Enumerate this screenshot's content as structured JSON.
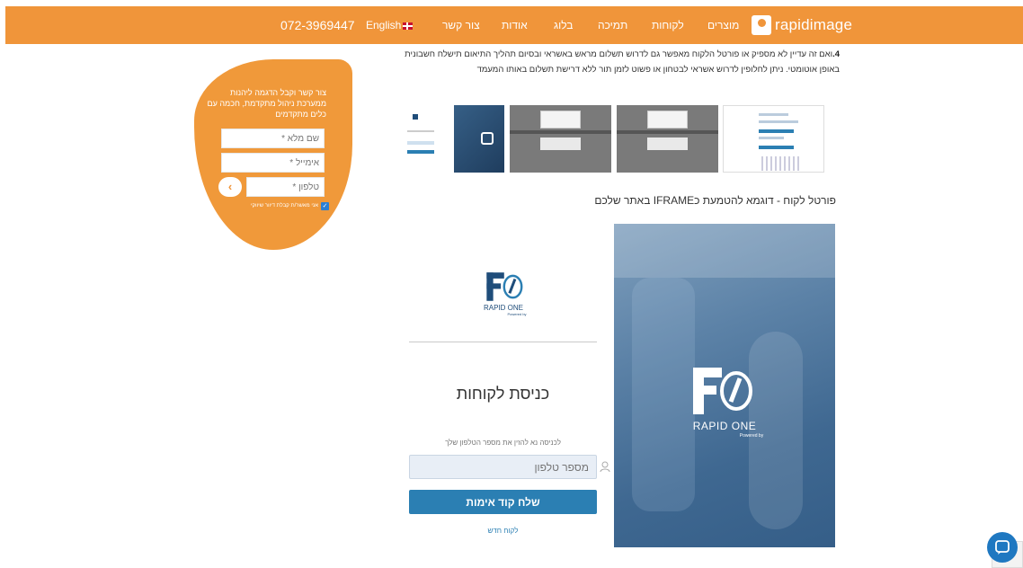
{
  "header": {
    "logo_text": "rapidimage",
    "nav": [
      "מוצרים",
      "לקוחות",
      "תמיכה",
      "בלוג",
      "אודות",
      "צור קשר"
    ],
    "language": "English",
    "phone": "072-3969447"
  },
  "article": {
    "paragraph_prefix": "4.",
    "paragraph": "ואם זה עדיין לא מספיק או פורטל הלקוח מאפשר גם לדרוש תשלום מראש באשראי ובסיום תהליך התיאום תישלח חשבונית באופן אוטומטי. ניתן לחלופין לדרוש אשראי לבטחון או פשוט לזמן תור ללא דרישת תשלום באותו המעמד",
    "iframe_title": "פורטל לקוח - דוגמא להטמעת כIFRAME באתר שלכם"
  },
  "portal": {
    "brand_name": "RAPID ONE",
    "powered_by": "Powered by",
    "login_title": "כניסת לקוחות",
    "login_hint": "לכניסה נא להזין את מספר הטלפון שלך",
    "phone_placeholder": "מספר טלפון",
    "send_button": "שלח קוד אימות",
    "new_client": "לקוח חדש"
  },
  "contact": {
    "text": "צור קשר וקבל הדגמה ליהנות ממערכת ניהול מתקדמת, חכמה עם כלים מתקדמים",
    "name_placeholder": "שם מלא *",
    "email_placeholder": "אימייל *",
    "phone_placeholder": "טלפון *",
    "go_button": "‹",
    "consent": "אני מאשר/ת קבלת דיוור שיווקי"
  },
  "icons": {
    "chat": "chat-icon",
    "user": "user-icon",
    "flag": "uk-flag-icon",
    "check": "check-icon"
  },
  "colors": {
    "brand_orange": "#f0953a",
    "portal_blue": "#2b7fb3",
    "chat_blue": "#1f78c1"
  }
}
